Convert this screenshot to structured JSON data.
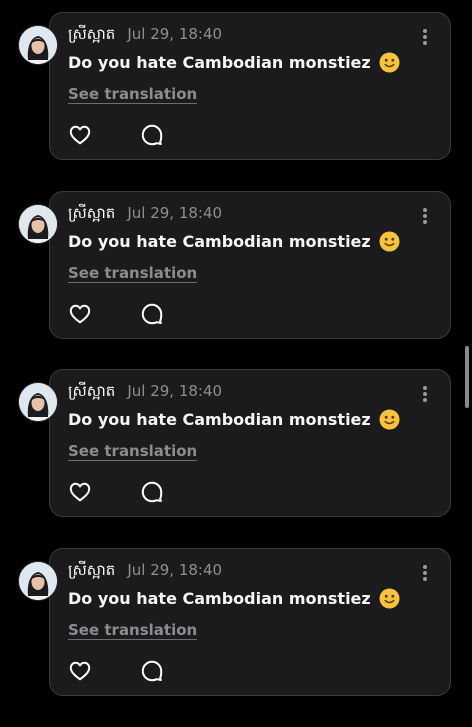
{
  "posts": [
    {
      "username": "ស្រីស្អាត",
      "timestamp": "Jul 29, 18:40",
      "text": "Do you hate Cambodian monstiez",
      "emoji": "slightly-smiling-face",
      "see_translation": "See translation"
    },
    {
      "username": "ស្រីស្អាត",
      "timestamp": "Jul 29, 18:40",
      "text": "Do you hate Cambodian monstiez",
      "emoji": "slightly-smiling-face",
      "see_translation": "See translation"
    },
    {
      "username": "ស្រីស្អាត",
      "timestamp": "Jul 29, 18:40",
      "text": "Do you hate Cambodian monstiez",
      "emoji": "slightly-smiling-face",
      "see_translation": "See translation"
    },
    {
      "username": "ស្រីស្អាត",
      "timestamp": "Jul 29, 18:40",
      "text": "Do you hate Cambodian monstiez",
      "emoji": "slightly-smiling-face",
      "see_translation": "See translation"
    }
  ],
  "icons": {
    "like": "heart-icon",
    "reply": "speech-bubble-icon",
    "more": "more-vertical-icon"
  },
  "colors": {
    "background": "#000000",
    "card": "#1b1b1d",
    "card_border": "#3b3b3e",
    "text": "#ffffff",
    "muted": "#8e8e93",
    "emoji": "#f6c33b"
  }
}
